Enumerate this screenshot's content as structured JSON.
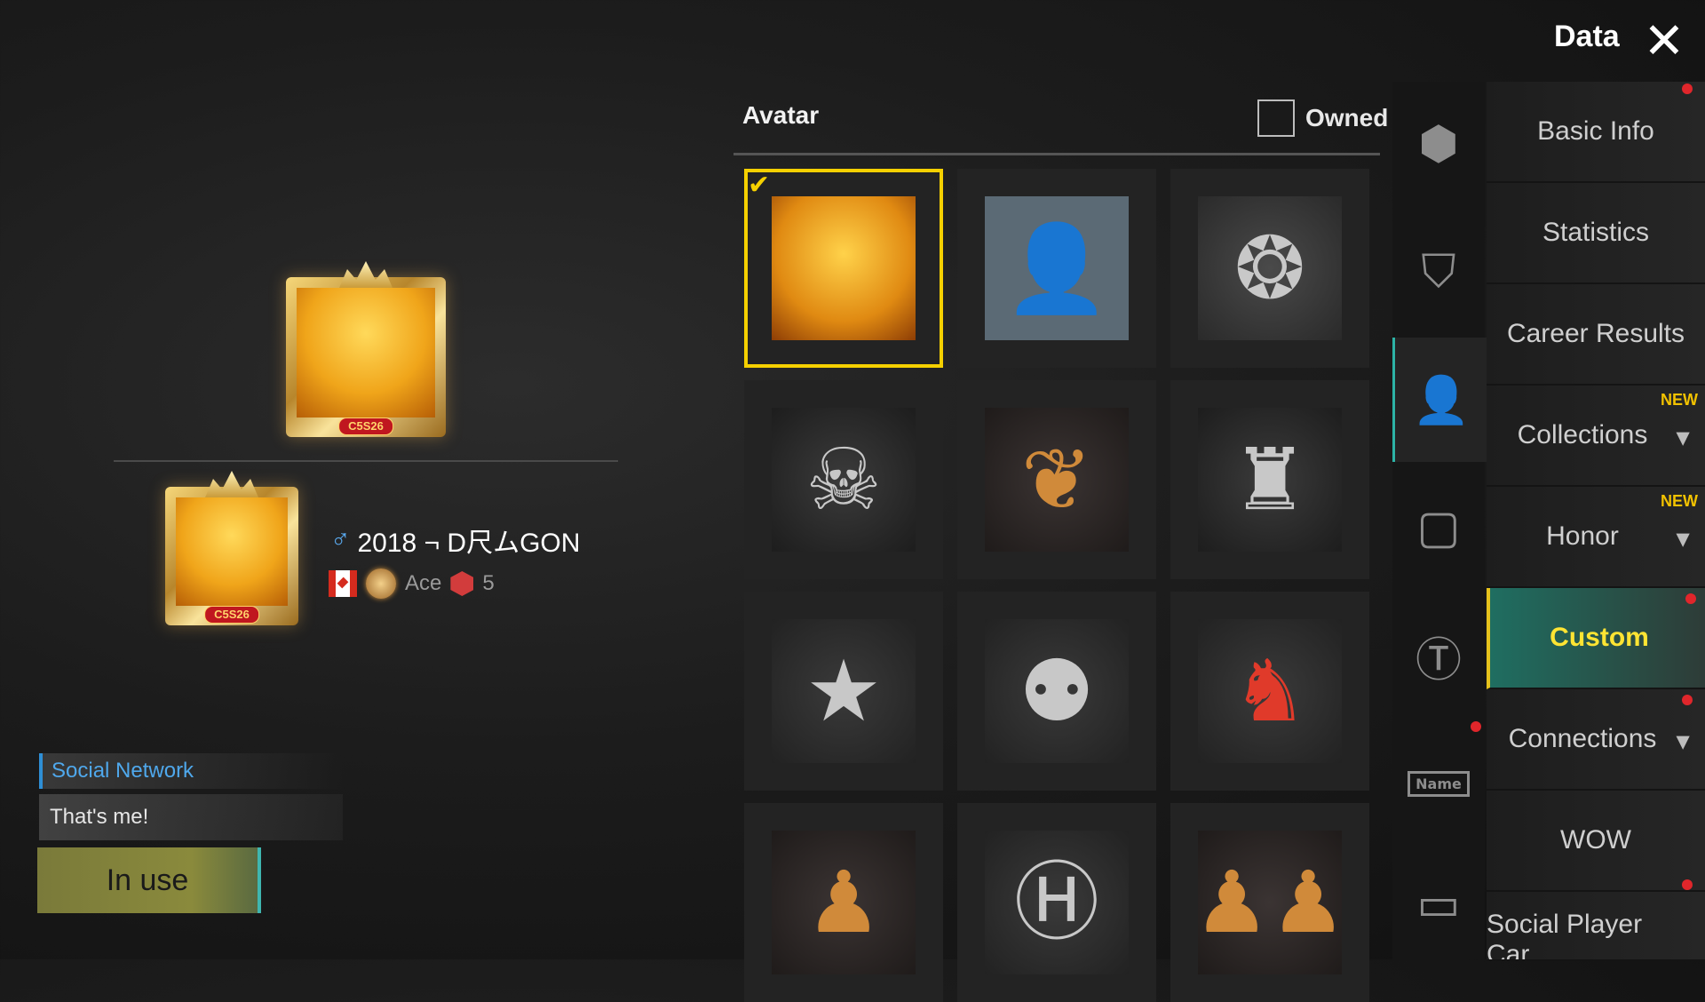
{
  "header": {
    "title": "Data",
    "close_icon": "close-icon"
  },
  "profile": {
    "frame_season_label": "C5S26",
    "player_name": "2018 ¬ D尺ムGON",
    "gender_icon": "male-icon",
    "tier_label": "Ace",
    "tier_level": "5",
    "social_label": "Social Network",
    "social_text": "That's me!",
    "inuse_label": "In use"
  },
  "avatar_panel": {
    "title": "Avatar",
    "owned_label": "Owned",
    "owned_checked": false,
    "items": [
      {
        "icon": "dragon-skin-avatar",
        "selected": true
      },
      {
        "icon": "default-person-avatar"
      },
      {
        "icon": "winged-emblem-avatar"
      },
      {
        "icon": "skull-emblem-avatar"
      },
      {
        "icon": "chicken-silhouette-avatar"
      },
      {
        "icon": "gunman-avatar"
      },
      {
        "icon": "star-medal-avatar"
      },
      {
        "icon": "squad-emblem-avatar"
      },
      {
        "icon": "rooster-emblem-avatar"
      },
      {
        "icon": "soldier-avatar"
      },
      {
        "icon": "medkit-avatar"
      },
      {
        "icon": "squad-silhouette-avatar"
      }
    ]
  },
  "rail": {
    "items": [
      {
        "icon": "helmet-frame-icon"
      },
      {
        "icon": "shield-icon"
      },
      {
        "icon": "avatar-icon",
        "active": true
      },
      {
        "icon": "frame-icon"
      },
      {
        "icon": "title-tag-icon"
      },
      {
        "icon": "name-card-icon",
        "label": "Name"
      },
      {
        "icon": "folder-icon"
      }
    ]
  },
  "nav": {
    "items": [
      {
        "label": "Basic Info"
      },
      {
        "label": "Statistics"
      },
      {
        "label": "Career Results"
      },
      {
        "label": "Collections",
        "badge": "NEW"
      },
      {
        "label": "Honor",
        "badge": "NEW"
      },
      {
        "label": "Custom",
        "active": true
      },
      {
        "label": "Connections"
      },
      {
        "label": "WOW"
      },
      {
        "label": "Social Player Car..."
      }
    ]
  },
  "colors": {
    "accent": "#2db3a6",
    "selected": "#f5d000",
    "new": "#f2c200",
    "dot": "#e0262b"
  }
}
